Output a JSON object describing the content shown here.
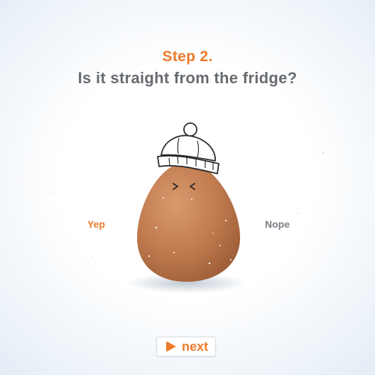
{
  "header": {
    "step": "Step 2.",
    "question": "Is it straight from the fridge?"
  },
  "options": {
    "yes": "Yep",
    "no": "Nope"
  },
  "next": {
    "label": "next",
    "icon": "play-icon"
  },
  "illustration": {
    "subject": "egg-icon",
    "accessory": "beanie-hat-icon",
    "face": "squinting-face-icon"
  },
  "colors": {
    "accent": "#ee7a2b",
    "text": "#676b70",
    "egg": "#c7845a"
  }
}
